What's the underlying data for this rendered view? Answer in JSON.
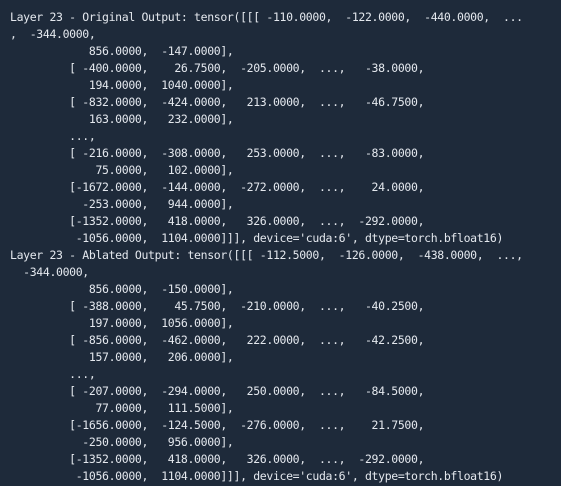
{
  "terminal": {
    "background": "#1e2a3a",
    "text_color": "#e4e8ee",
    "lines": [
      "Layer 23 - Original Output: tensor([[[ -110.0000,  -122.0000,  -440.0000,  ...",
      ",  -344.0000,",
      "            856.0000,  -147.0000],",
      "         [ -400.0000,    26.7500,  -205.0000,  ...,   -38.0000,",
      "            194.0000,  1040.0000],",
      "         [ -832.0000,  -424.0000,   213.0000,  ...,   -46.7500,",
      "            163.0000,   232.0000],",
      "         ...,",
      "         [ -216.0000,  -308.0000,   253.0000,  ...,   -83.0000,",
      "             75.0000,   102.0000],",
      "         [-1672.0000,  -144.0000,  -272.0000,  ...,    24.0000,",
      "           -253.0000,   944.0000],",
      "         [-1352.0000,   418.0000,   326.0000,  ...,  -292.0000,",
      "          -1056.0000,  1104.0000]]], device='cuda:6', dtype=torch.bfloat16)",
      "Layer 23 - Ablated Output: tensor([[[ -112.5000,  -126.0000,  -438.0000,  ...,",
      "  -344.0000,",
      "            856.0000,  -150.0000],",
      "         [ -388.0000,    45.7500,  -210.0000,  ...,   -40.2500,",
      "            197.0000,  1056.0000],",
      "         [ -856.0000,  -462.0000,   222.0000,  ...,   -42.2500,",
      "            157.0000,   206.0000],",
      "         ...,",
      "         [ -207.0000,  -294.0000,   250.0000,  ...,   -84.5000,",
      "             77.0000,   111.5000],",
      "         [-1656.0000,  -124.5000,  -276.0000,  ...,    21.7500,",
      "           -250.0000,   956.0000],",
      "         [-1352.0000,   418.0000,   326.0000,  ...,  -292.0000,",
      "          -1056.0000,  1104.0000]]], device='cuda:6', dtype=torch.bfloat16)"
    ]
  }
}
